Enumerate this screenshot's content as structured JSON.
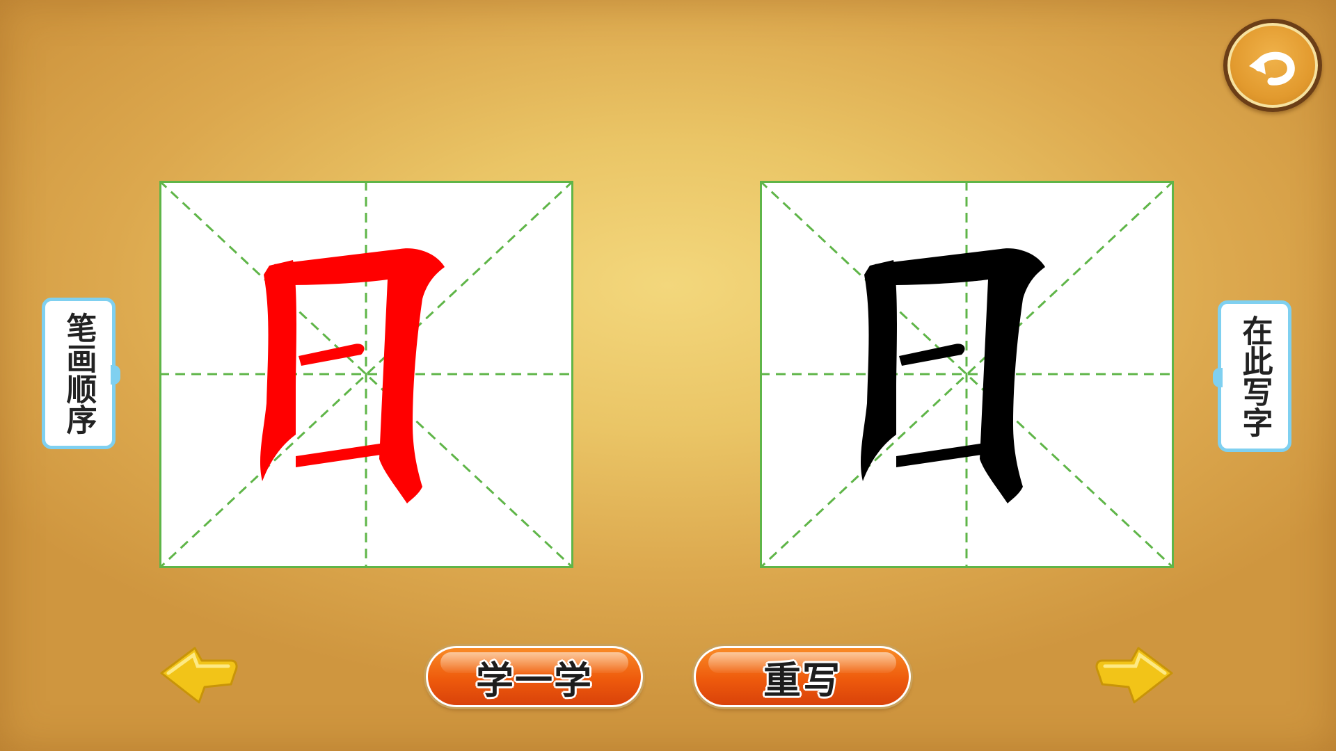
{
  "left_panel": {
    "label": "笔画顺序",
    "character": "日",
    "stroke_color": "#ff0000"
  },
  "right_panel": {
    "label": "在此写字",
    "character": "日",
    "stroke_color": "#000000"
  },
  "buttons": {
    "learn_label": "学一学",
    "rewrite_label": "重写"
  },
  "icons": {
    "back": "back-arrow-icon",
    "prev": "prev-arrow-icon",
    "next": "next-arrow-icon"
  },
  "colors": {
    "grid_line": "#5fb548",
    "button_orange": "#ee5a0c",
    "arrow_yellow": "#f2c418",
    "label_border": "#7fd0f0"
  }
}
